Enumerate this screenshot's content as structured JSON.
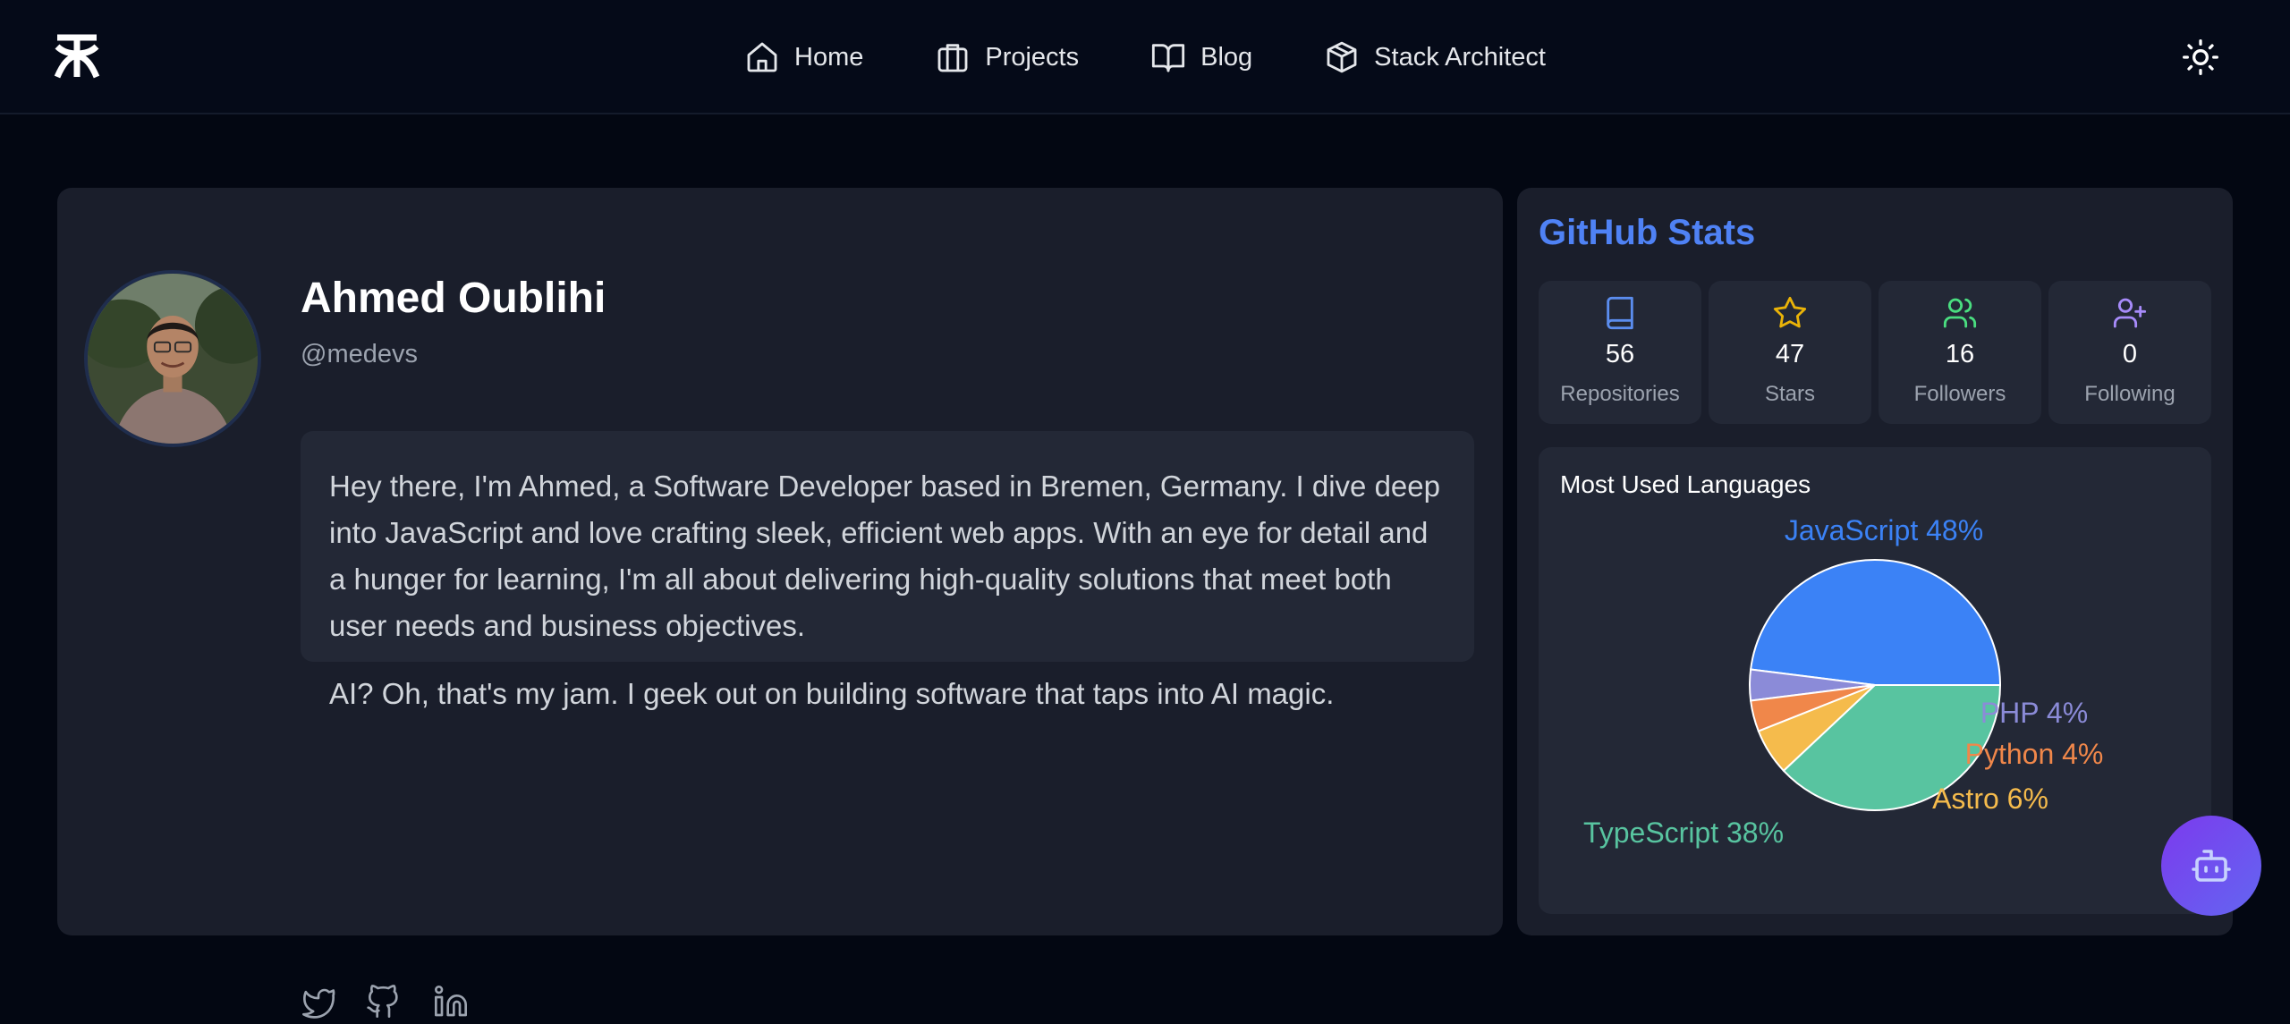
{
  "nav": {
    "items": [
      {
        "label": "Home",
        "icon": "home-icon"
      },
      {
        "label": "Projects",
        "icon": "briefcase-icon"
      },
      {
        "label": "Blog",
        "icon": "book-open-icon"
      },
      {
        "label": "Stack Architect",
        "icon": "box-icon"
      }
    ]
  },
  "profile": {
    "name": "Ahmed Oublihi",
    "handle": "@medevs",
    "bio": [
      "Hey there, I'm Ahmed, a Software Developer based in Bremen, Germany. I dive deep into JavaScript and love crafting sleek, efficient web apps. With an eye for detail and a hunger for learning, I'm all about delivering high-quality solutions that meet both user needs and business objectives.",
      "AI? Oh, that's my jam. I geek out on building software that taps into AI magic."
    ],
    "socials": [
      "twitter-icon",
      "github-icon",
      "linkedin-icon"
    ]
  },
  "stats": {
    "title": "GitHub Stats",
    "tiles": [
      {
        "value": "56",
        "label": "Repositories",
        "icon": "book-icon",
        "color": "#5b8def"
      },
      {
        "value": "47",
        "label": "Stars",
        "icon": "star-icon",
        "color": "#eab308"
      },
      {
        "value": "16",
        "label": "Followers",
        "icon": "users-icon",
        "color": "#4ade80"
      },
      {
        "value": "0",
        "label": "Following",
        "icon": "user-plus-icon",
        "color": "#a78bfa"
      }
    ],
    "languages_title": "Most Used Languages"
  },
  "chart_data": {
    "type": "pie",
    "title": "Most Used Languages",
    "slices": [
      {
        "name": "JavaScript",
        "value": 48,
        "label": "JavaScript 48%",
        "color": "#3b82f6"
      },
      {
        "name": "PHP",
        "value": 4,
        "label": "PHP 4%",
        "color": "#8b8bd8"
      },
      {
        "name": "Python",
        "value": 4,
        "label": "Python 4%",
        "color": "#f0874a"
      },
      {
        "name": "Astro",
        "value": 6,
        "label": "Astro 6%",
        "color": "#f5bb4c"
      },
      {
        "name": "TypeScript",
        "value": 38,
        "label": "TypeScript 38%",
        "color": "#58c4a0"
      }
    ]
  }
}
